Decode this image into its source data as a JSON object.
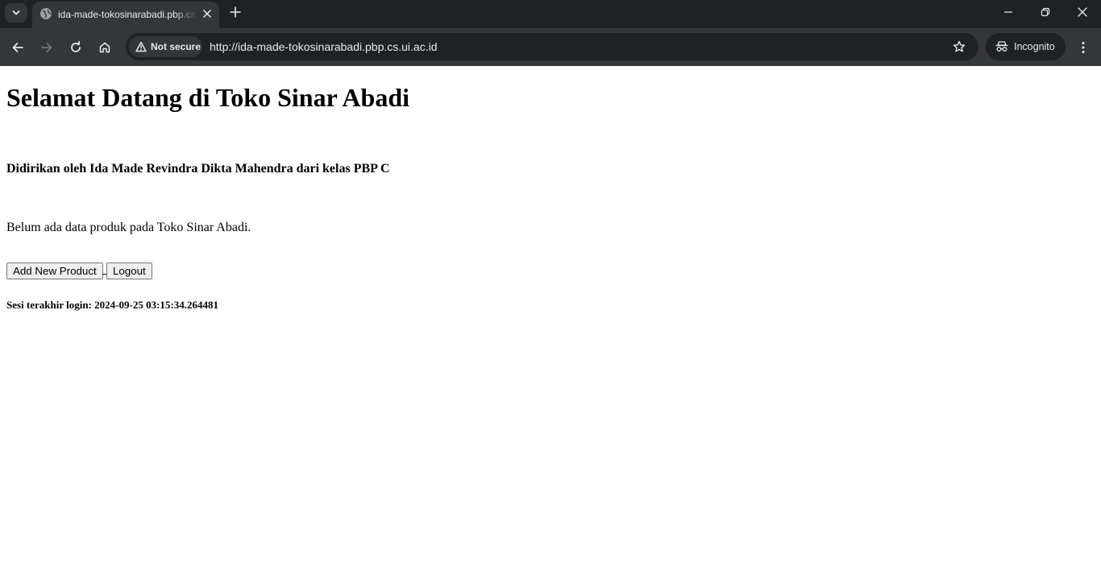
{
  "browser": {
    "tab": {
      "title": "ida-made-tokosinarabadi.pbp.cs.ui.ac.id"
    },
    "omnibox": {
      "security_label": "Not secure",
      "url": "http://ida-made-tokosinarabadi.pbp.cs.ui.ac.id"
    },
    "profile": {
      "label": "Incognito"
    },
    "colors": {
      "tabbar_bg": "#202124",
      "toolbar_bg": "#35363a",
      "text": "#e8eaed"
    }
  },
  "page": {
    "title": "Selamat Datang di Toko Sinar Abadi",
    "founder_line": "Didirikan oleh Ida Made Revindra Dikta Mahendra dari kelas PBP C",
    "empty_message": "Belum ada data produk pada Toko Sinar Abadi.",
    "buttons": {
      "add_product": "Add New Product",
      "logout": "Logout"
    },
    "last_login": "Sesi terakhir login: 2024-09-25 03:15:34.264481"
  },
  "icons": {
    "tab_search": "chevron-down-icon",
    "favicon": "globe-icon",
    "tab_close": "close-icon",
    "new_tab": "plus-icon",
    "minimize": "minimize-icon",
    "restore": "restore-icon",
    "window_close": "close-icon",
    "back": "back-arrow-icon",
    "forward": "forward-arrow-icon",
    "reload": "reload-icon",
    "home": "home-icon",
    "security": "warning-triangle-icon",
    "bookmark": "star-icon",
    "incognito": "incognito-icon",
    "menu": "kebab-menu-icon"
  }
}
